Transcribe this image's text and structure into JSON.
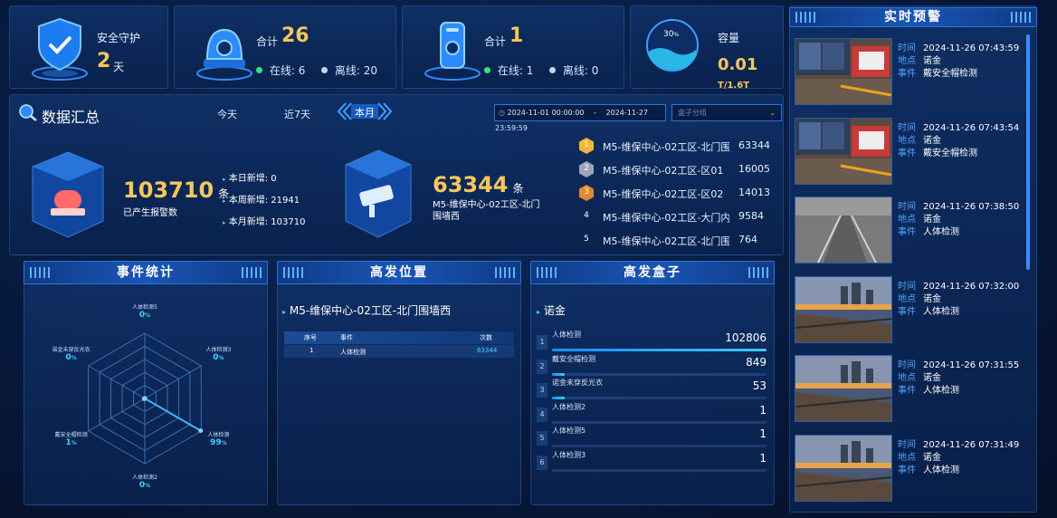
{
  "stats": {
    "security": {
      "label": "安全守护",
      "value": "2",
      "unit": "天"
    },
    "cameras": {
      "total_label": "合计",
      "total": "26",
      "online_label": "在线:",
      "online": "6",
      "offline_label": "离线:",
      "offline": "20"
    },
    "boxes": {
      "total_label": "合计",
      "total": "1",
      "online_label": "在线:",
      "online": "1",
      "offline_label": "离线:",
      "offline": "0"
    },
    "capacity": {
      "label": "容量",
      "percent_value": "30",
      "percent_unit": "%",
      "used": "0.01",
      "unit_total": "T/1.6T"
    }
  },
  "summary": {
    "title": "数据汇总",
    "tabs": [
      "今天",
      "近7天",
      "本月"
    ],
    "active_tab": "本月",
    "date_start": "2024-11-01 00:00:00",
    "date_sep": "-",
    "date_end": "2024-11-27 23:59:59",
    "box_select_placeholder": "盒子分组",
    "alarms": {
      "total": "103710",
      "unit": "条",
      "label": "已产生报警数",
      "today_label": "本日新增:",
      "today": "0",
      "week_label": "本周新增:",
      "week": "21941",
      "month_label": "本月新增:",
      "month": "103710"
    },
    "top_location": {
      "count": "63344",
      "unit": "条",
      "name": "M5-维保中心-02工区-北门围墙西"
    },
    "ranking": [
      {
        "rank": "1",
        "name": "M5-维保中心-02工区-北门围...",
        "value": "63344"
      },
      {
        "rank": "2",
        "name": "M5-维保中心-02工区-区01",
        "value": "16005"
      },
      {
        "rank": "3",
        "name": "M5-维保中心-02工区-区02",
        "value": "14013"
      },
      {
        "rank": "4",
        "name": "M5-维保中心-02工区-大门内",
        "value": "9584"
      },
      {
        "rank": "5",
        "name": "M5-维保中心-02工区-北门围...",
        "value": "764"
      }
    ]
  },
  "events": {
    "title": "事件统计",
    "radar": [
      {
        "name": "人体检测5",
        "pct": "0"
      },
      {
        "name": "人体检测3",
        "pct": "0"
      },
      {
        "name": "人体检测",
        "pct": "99"
      },
      {
        "name": "人体检测2",
        "pct": "0"
      },
      {
        "name": "戴安全帽检测",
        "pct": "1"
      },
      {
        "name": "诺金未穿反光衣",
        "pct": "0"
      }
    ],
    "pct_unit": "%"
  },
  "locations": {
    "title": "高发位置",
    "selected": "M5-维保中心-02工区-北门围墙西",
    "columns": [
      "序号",
      "事件",
      "次数"
    ],
    "rows": [
      {
        "idx": "1",
        "event": "人体检测",
        "count": "63344"
      }
    ]
  },
  "boxes_rank": {
    "title": "高发盒子",
    "selected": "诺金",
    "items": [
      {
        "idx": "1",
        "name": "人体检测",
        "value": "102806",
        "ratio": 1.0
      },
      {
        "idx": "2",
        "name": "戴安全帽检测",
        "value": "849",
        "ratio": 0.0083
      },
      {
        "idx": "3",
        "name": "诺金未穿反光衣",
        "value": "53",
        "ratio": 0.0005
      },
      {
        "idx": "4",
        "name": "人体检测2",
        "value": "1",
        "ratio": 0.0
      },
      {
        "idx": "5",
        "name": "人体检测5",
        "value": "1",
        "ratio": 0.0
      },
      {
        "idx": "6",
        "name": "人体检测3",
        "value": "1",
        "ratio": 0.0
      }
    ]
  },
  "alerts": {
    "title": "实时预警",
    "time_label": "时间",
    "place_label": "地点",
    "event_label": "事件",
    "items": [
      {
        "time": "2024-11-26 07:43:59",
        "place": "诺金",
        "event": "戴安全帽检测",
        "scene": "indoor"
      },
      {
        "time": "2024-11-26 07:43:54",
        "place": "诺金",
        "event": "戴安全帽检测",
        "scene": "indoor"
      },
      {
        "time": "2024-11-26 07:38:50",
        "place": "诺金",
        "event": "人体检测",
        "scene": "night"
      },
      {
        "time": "2024-11-26 07:32:00",
        "place": "诺金",
        "event": "人体检测",
        "scene": "dusk"
      },
      {
        "time": "2024-11-26 07:31:55",
        "place": "诺金",
        "event": "人体检测",
        "scene": "dusk"
      },
      {
        "time": "2024-11-26 07:31:49",
        "place": "诺金",
        "event": "人体检测",
        "scene": "dusk"
      }
    ]
  },
  "colors": {
    "accent": "#45d2ff",
    "gold": "#f6c75b",
    "online": "#3fe07a",
    "offline": "#c9d3e3"
  }
}
